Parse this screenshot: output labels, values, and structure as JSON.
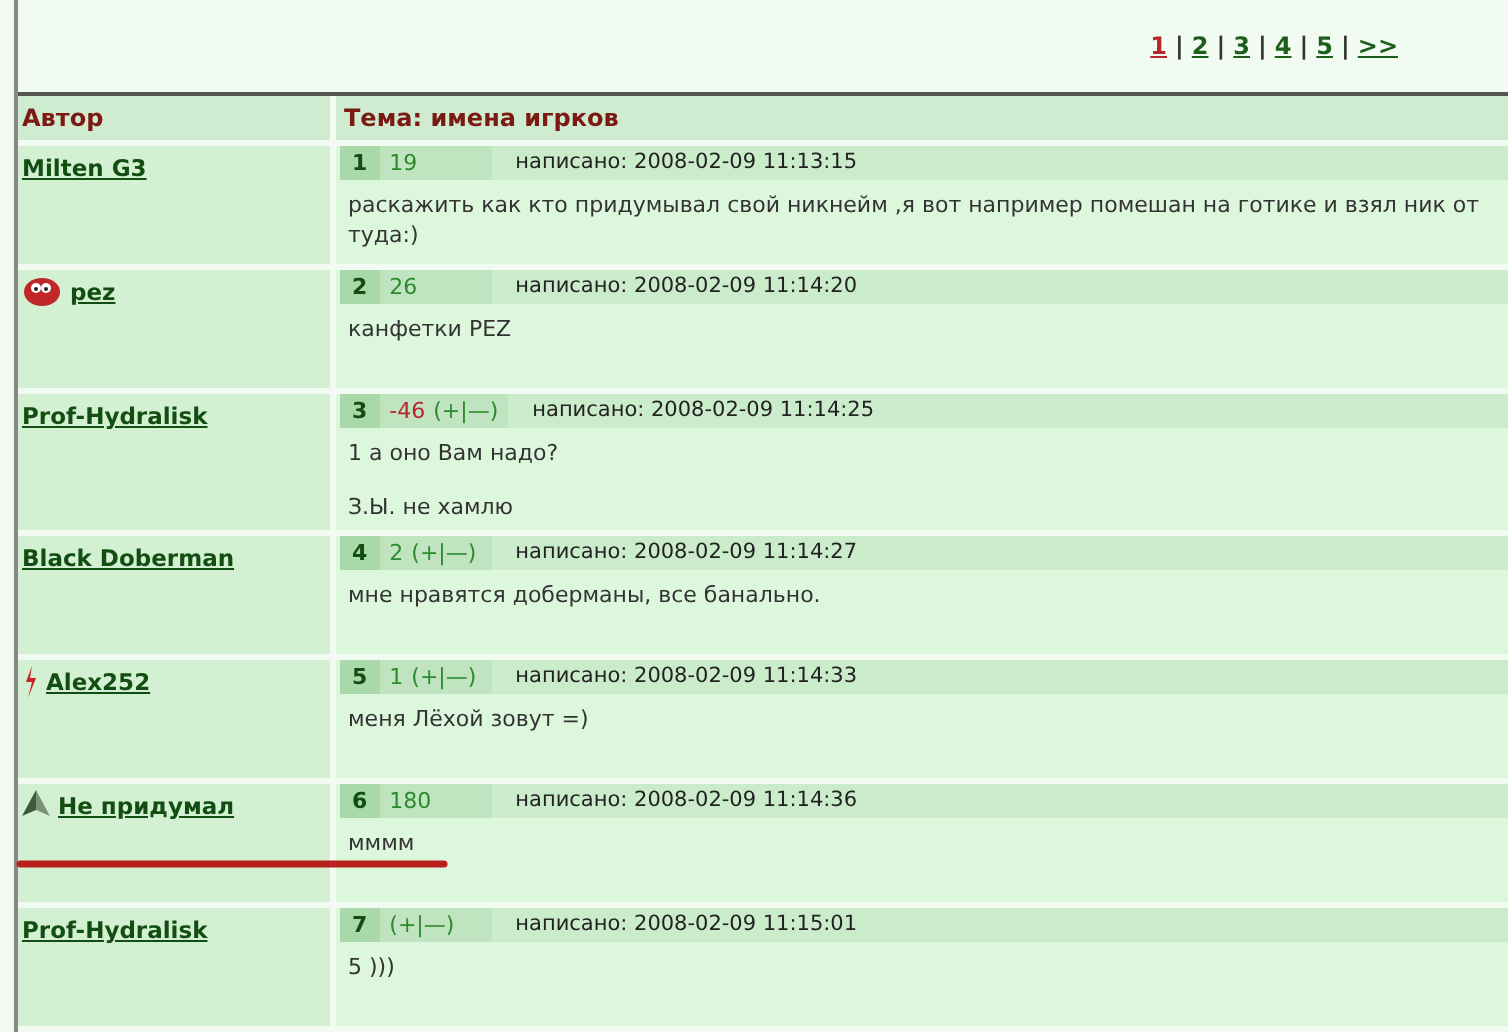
{
  "pagination": [
    {
      "label": "1",
      "selected": true
    },
    {
      "label": "2",
      "selected": false
    },
    {
      "label": "3",
      "selected": false
    },
    {
      "label": "4",
      "selected": false
    },
    {
      "label": "5",
      "selected": false
    },
    {
      "label": ">>",
      "selected": false
    }
  ],
  "pagination_separator": "|",
  "table": {
    "columns": [
      "Автор",
      "Тема: имена игрков"
    ],
    "posts": [
      {
        "kind": "plain",
        "author": "Milten G3",
        "number": "1",
        "score": "19",
        "negative": false,
        "posted": "написано: 2008-02-09 11:13:15",
        "paragraphs": [
          "раскажить как кто придумывал свой никнейм ,я вот например помешан на готике и взял ник от туда:)"
        ],
        "underlined": false
      },
      {
        "kind": "blob",
        "author": "pez",
        "number": "2",
        "score": "26",
        "negative": false,
        "posted": "написано: 2008-02-09 11:14:20",
        "paragraphs": [
          "канфетки PEZ"
        ],
        "underlined": false
      },
      {
        "kind": "plain",
        "author": "Prof-Hydralisk",
        "number": "3",
        "score": "-46",
        "negative": true,
        "vote": "(+|—)",
        "posted": "написано: 2008-02-09 11:14:25",
        "paragraphs": [
          "1 а оно Вам надо?",
          "З.Ы. не хамлю"
        ],
        "underlined": false
      },
      {
        "kind": "plain",
        "author": "Black Doberman",
        "number": "4",
        "score": "2",
        "negative": false,
        "vote": "(+|—)",
        "posted": "написано: 2008-02-09 11:14:27",
        "paragraphs": [
          "мне нравятся доберманы, все банально."
        ],
        "underlined": false
      },
      {
        "kind": "spark",
        "author": "Alex252",
        "number": "5",
        "score": "1",
        "negative": false,
        "vote": "(+|—)",
        "posted": "написано: 2008-02-09 11:14:33",
        "paragraphs": [
          "меня Лёхой зовут =)"
        ],
        "underlined": false
      },
      {
        "kind": "pyramid",
        "author": "Не придумал",
        "number": "6",
        "score": "180",
        "negative": false,
        "posted": "написано: 2008-02-09 11:14:36",
        "paragraphs": [
          "мммм"
        ],
        "underlined": true
      },
      {
        "kind": "plain",
        "author": "Prof-Hydralisk",
        "number": "7",
        "vote": "(+|—)",
        "posted": "написано: 2008-02-09 11:15:01",
        "paragraphs": [
          "5 )))"
        ],
        "underlined": false
      }
    ]
  }
}
